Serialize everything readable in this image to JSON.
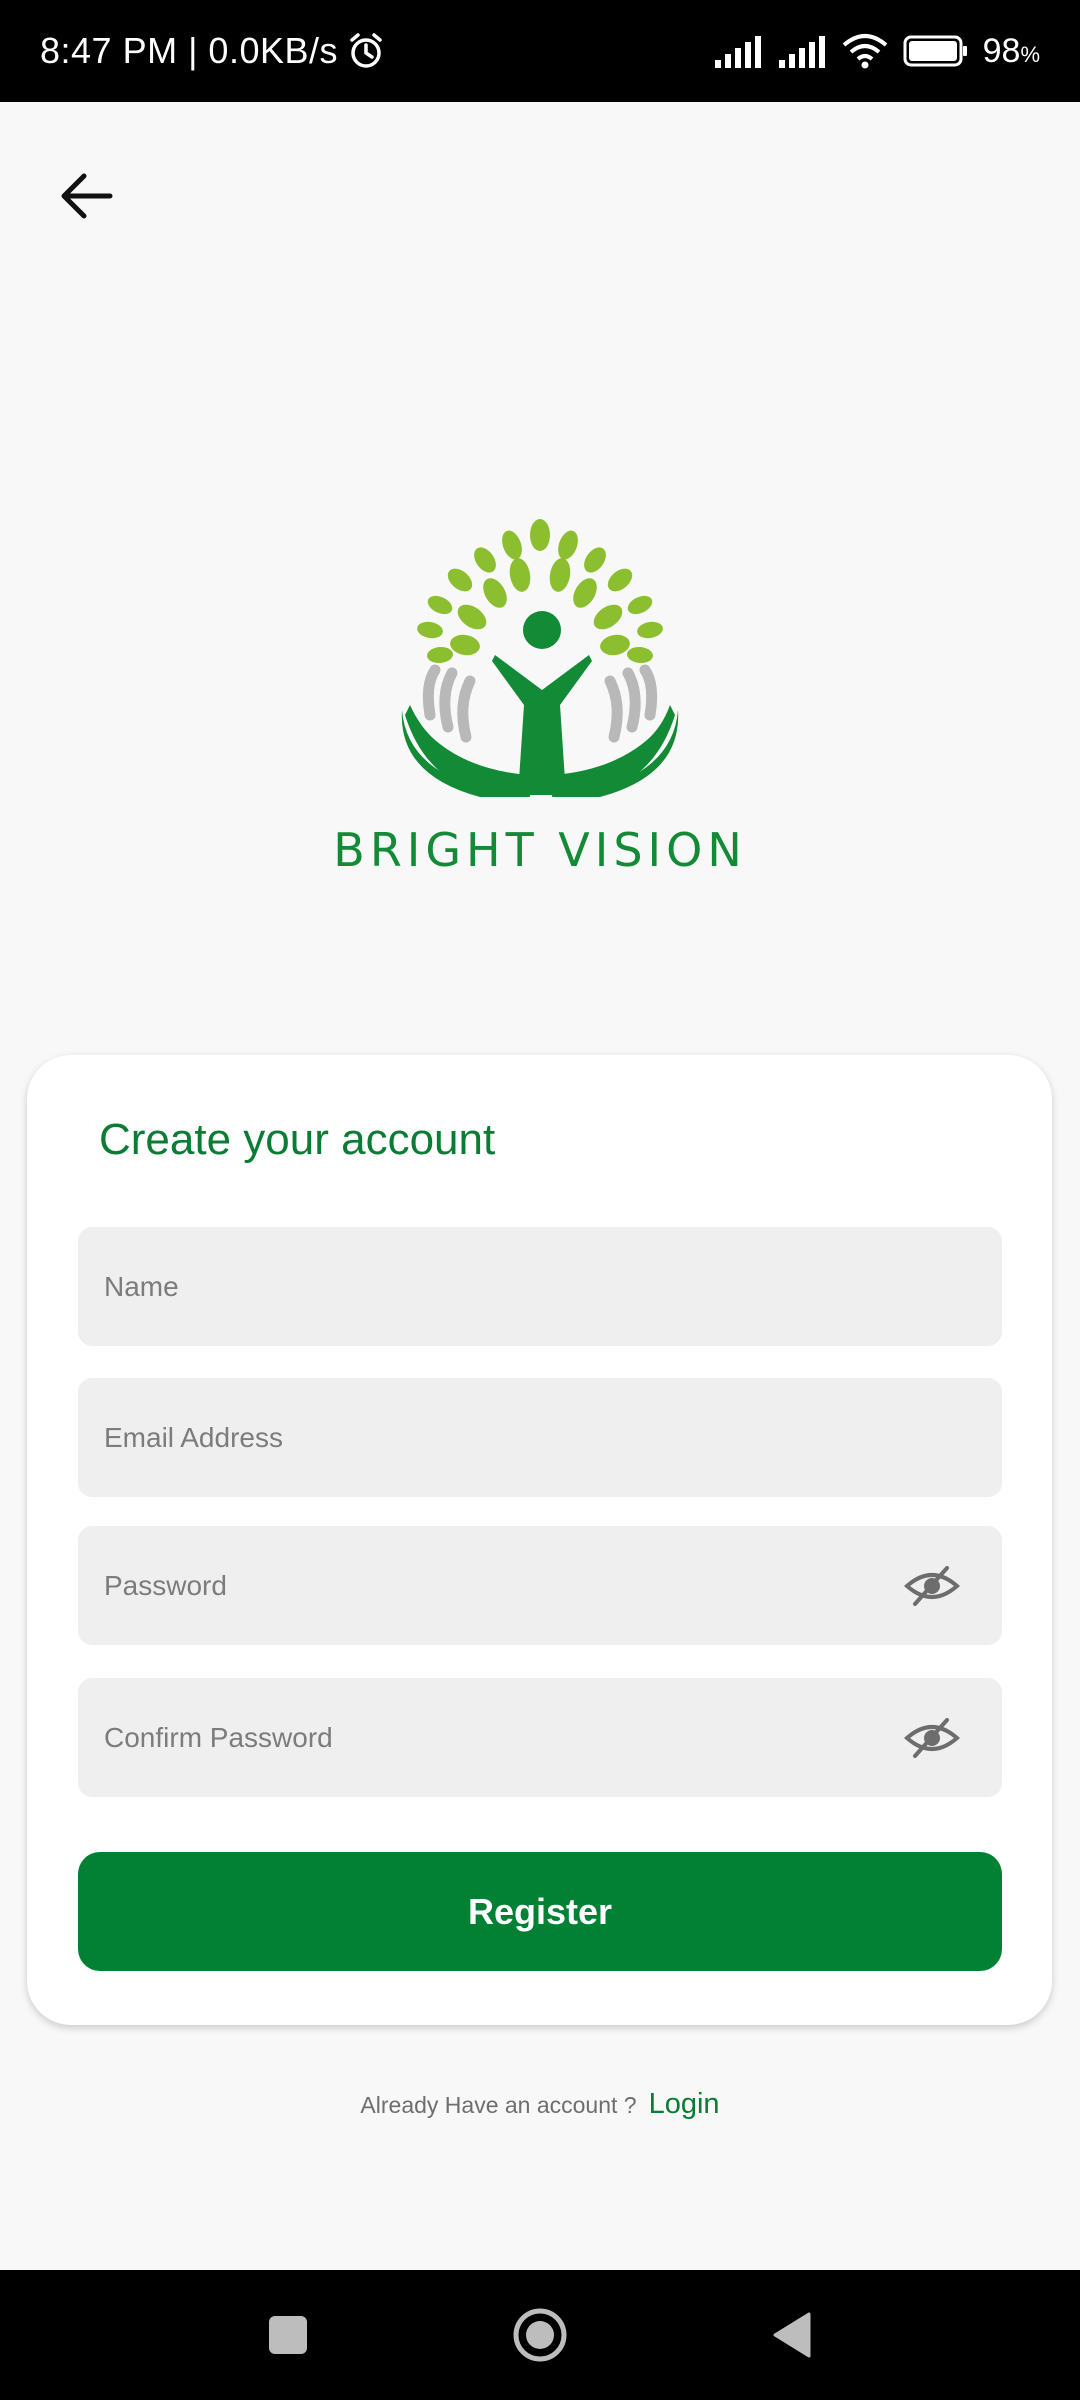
{
  "status_bar": {
    "time_info": "8:47 PM | 0.0KB/s",
    "battery_pct": "98",
    "battery_sign": "%",
    "icons": [
      "alarm-icon",
      "signal-icon",
      "signal-icon",
      "wifi-icon",
      "battery-icon"
    ]
  },
  "header": {
    "back_icon": "arrow-left-icon"
  },
  "logo": {
    "brand_text": "BRIGHT VISION",
    "primary_color": "#138a36",
    "leaf_color": "#8cbf2f"
  },
  "form": {
    "title": "Create your account",
    "name_placeholder": "Name",
    "email_placeholder": "Email Address",
    "password_placeholder": "Password",
    "confirm_placeholder": "Confirm Password",
    "register_label": "Register",
    "accent_color": "#028135"
  },
  "footer": {
    "prompt": "Already Have an account ?",
    "login_label": "Login"
  },
  "nav": {
    "icons": [
      "recents-square-icon",
      "home-circle-icon",
      "back-triangle-icon"
    ]
  }
}
